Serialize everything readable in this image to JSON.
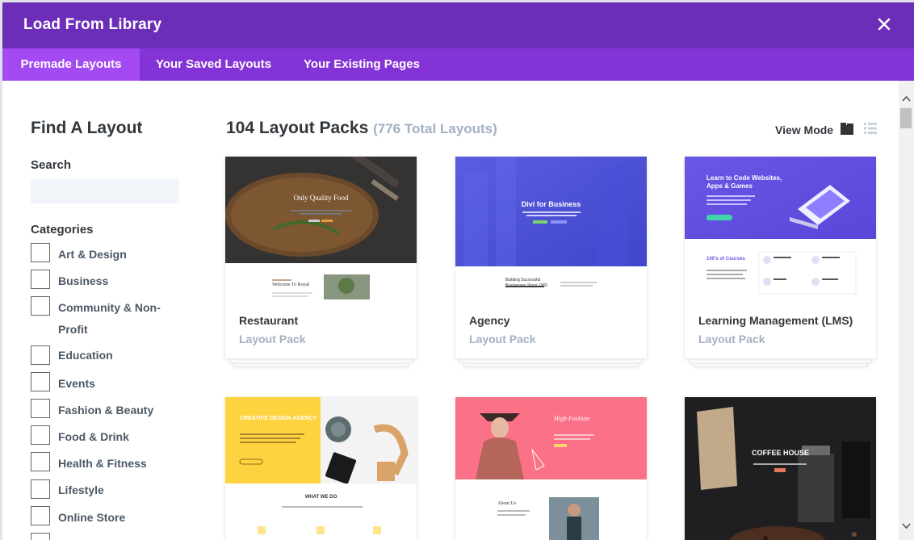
{
  "header": {
    "title": "Load From Library"
  },
  "tabs": [
    {
      "label": "Premade Layouts",
      "active": true
    },
    {
      "label": "Your Saved Layouts",
      "active": false
    },
    {
      "label": "Your Existing Pages",
      "active": false
    }
  ],
  "sidebar": {
    "title": "Find A Layout",
    "search_label": "Search",
    "search_value": "",
    "search_placeholder": "",
    "categories_label": "Categories",
    "categories": [
      {
        "label": "Art & Design"
      },
      {
        "label": "Business"
      },
      {
        "label": "Community & Non-Profit"
      },
      {
        "label": "Education"
      },
      {
        "label": "Events"
      },
      {
        "label": "Fashion & Beauty"
      },
      {
        "label": "Food & Drink"
      },
      {
        "label": "Health & Fitness"
      },
      {
        "label": "Lifestyle"
      },
      {
        "label": "Online Store"
      }
    ]
  },
  "main": {
    "count_title": "104 Layout Packs",
    "count_sub": "(776 Total Layouts)",
    "view_mode_label": "View Mode",
    "view_mode_icons": [
      "grid-view-icon",
      "list-view-icon"
    ],
    "cards": [
      {
        "name": "Restaurant",
        "type": "Layout Pack",
        "thumb": {
          "hero_text": "Only Quality Food",
          "lower_text": "Welcome To Royal"
        }
      },
      {
        "name": "Agency",
        "type": "Layout Pack",
        "thumb": {
          "hero_text": "Divi for Business",
          "lower_text": "Building Successful Businesses Since 1965"
        }
      },
      {
        "name": "Learning Management (LMS)",
        "type": "Layout Pack",
        "thumb": {
          "hero_text": "Learn to Code Websites, Apps & Games",
          "lower_text": "100's of Courses"
        }
      },
      {
        "name": "",
        "type": "",
        "thumb": {
          "hero_text": "CREATIVE DESIGN AGENCY",
          "lower_text": "WHAT WE DO"
        }
      },
      {
        "name": "",
        "type": "",
        "thumb": {
          "hero_text": "High Fashion",
          "lower_text": "About Us"
        }
      },
      {
        "name": "",
        "type": "",
        "thumb": {
          "hero_text": "COFFEE HOUSE",
          "lower_text": ""
        }
      }
    ]
  },
  "colors": {
    "header_bg": "#6c2eb9",
    "tabs_bg": "#8434d6",
    "active_tab_bg": "#a44af2",
    "heading_text": "#32373c",
    "muted_text": "#a2b0c1"
  }
}
